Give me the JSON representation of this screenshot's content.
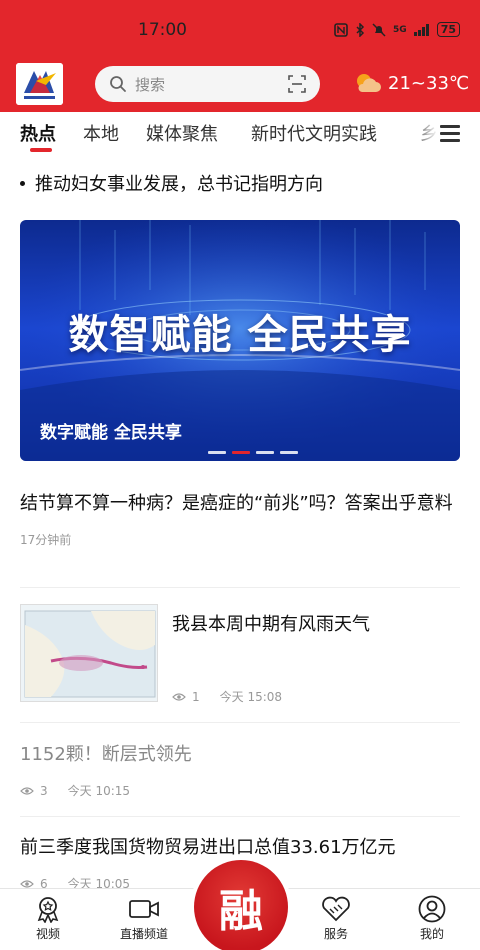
{
  "status": {
    "time": "17:00",
    "battery": "75",
    "network": "5G"
  },
  "search": {
    "placeholder": "搜索"
  },
  "weather": {
    "temp": "21~33℃"
  },
  "tabs": [
    "热点",
    "本地",
    "媒体聚焦",
    "新时代文明实践",
    "乡"
  ],
  "headline": "推动妇女事业发展，总书记指明方向",
  "banner": {
    "title": "数智赋能 全民共享",
    "caption": "数字赋能 全民共享",
    "slides": 4,
    "active": 2
  },
  "articles": [
    {
      "title": "结节算不算一种病？是癌症的“前兆”吗？答案出乎意料",
      "time": "17分钟前"
    },
    {
      "title": "我县本周中期有风雨天气",
      "views": "1",
      "time": "今天 15:08"
    },
    {
      "title": "1152颗！断层式领先",
      "views": "3",
      "time": "今天 10:15"
    },
    {
      "title": "前三季度我国货物贸易进出口总值33.61万亿元",
      "views": "6",
      "time": "今天 10:05"
    }
  ],
  "nav": {
    "video": "视频",
    "live": "直播频道",
    "center": "融",
    "service": "服务",
    "mine": "我的"
  },
  "colors": {
    "brand_red": "#e3262c",
    "banner_blue": "#1b46d0"
  }
}
